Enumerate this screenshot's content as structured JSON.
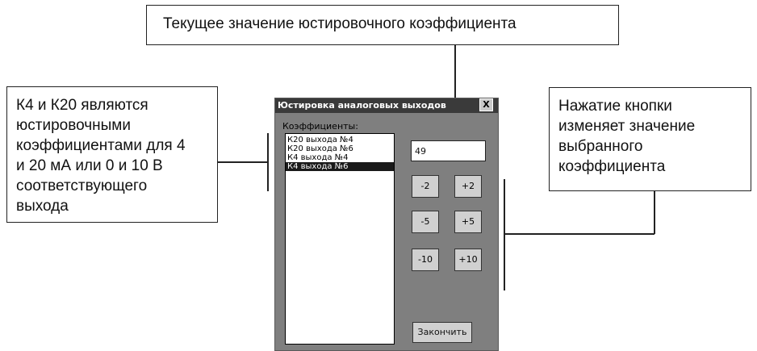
{
  "callouts": {
    "top": "Текущее значение юстировочного коэффициента",
    "left": [
      "К4 и К20 являются",
      "юстировочными",
      "коэффициентами для 4",
      "и 20 мА или 0 и 10 В",
      "соответствующего",
      "выхода"
    ],
    "right": [
      "Нажатие кнопки",
      "изменяет значение",
      "выбранного",
      "коэффициента"
    ]
  },
  "dialog": {
    "title": "Юстировка аналоговых выходов",
    "close_label": "X",
    "list_label": "Коэффициенты:",
    "items": [
      "К20 выхода №4",
      "К20 выхода №6",
      "К4  выхода №4",
      "К4  выхода №6"
    ],
    "selected_index": 3,
    "current_value": "49",
    "buttons": {
      "minus2": "-2",
      "plus2": "+2",
      "minus5": "-5",
      "plus5": "+5",
      "minus10": "-10",
      "plus10": "+10"
    },
    "finish_label": "Закончить"
  }
}
